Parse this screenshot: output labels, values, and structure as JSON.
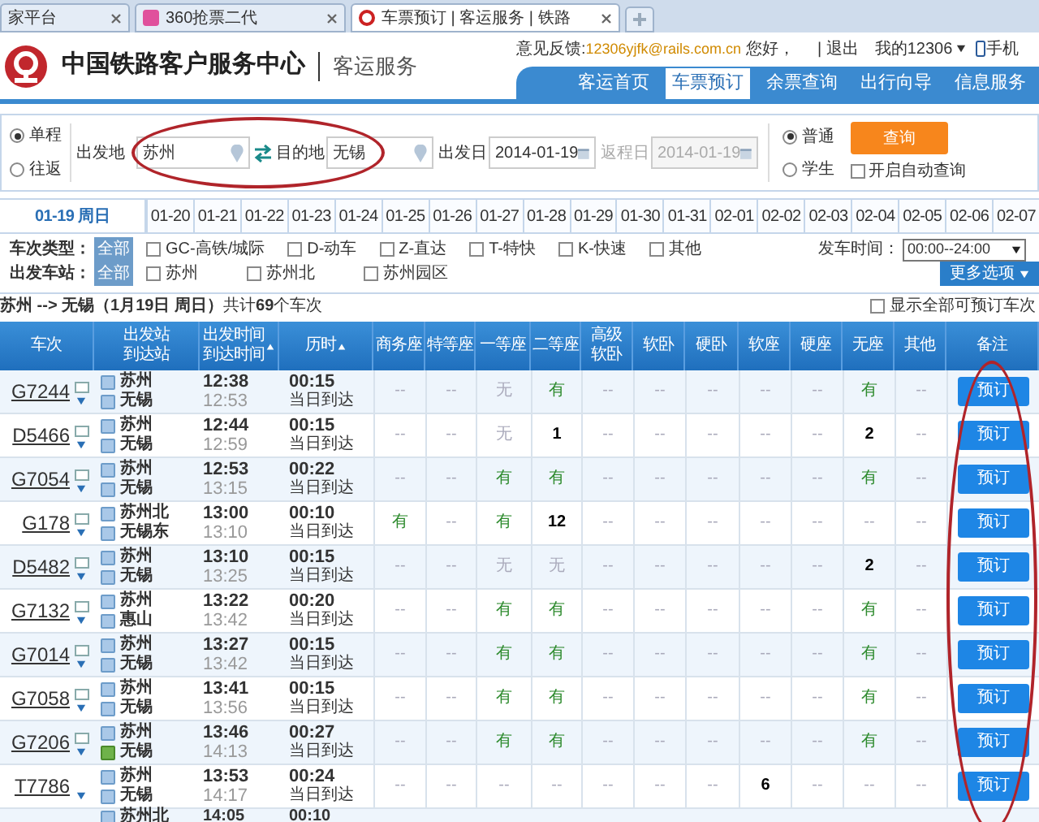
{
  "browser_tabs": [
    {
      "label": "家平台",
      "selected": false,
      "icon": false
    },
    {
      "label": "360抢票二代",
      "selected": false,
      "icon": true
    },
    {
      "label": "车票预订 | 客运服务 | 铁路",
      "selected": true,
      "icon": true
    }
  ],
  "header": {
    "title": "中国铁路客户服务中心",
    "subtitle": "客运服务",
    "feedback_label": "意见反馈:",
    "feedback_email": "12306yjfk@rails.com.cn",
    "greeting": "您好，",
    "logout": "| 退出",
    "my_account": "我的12306",
    "mobile": "手机"
  },
  "nav": [
    {
      "label": "客运首页",
      "selected": false
    },
    {
      "label": "车票预订",
      "selected": true
    },
    {
      "label": "余票查询",
      "selected": false
    },
    {
      "label": "出行向导",
      "selected": false
    },
    {
      "label": "信息服务",
      "selected": false
    }
  ],
  "search": {
    "trip_types": [
      {
        "label": "单程",
        "selected": true
      },
      {
        "label": "往返",
        "selected": false
      }
    ],
    "from_label": "出发地",
    "from": "苏州",
    "to_label": "目的地",
    "to": "无锡",
    "date_label": "出发日",
    "date": "2014-01-19",
    "return_label": "返程日",
    "return_date": "2014-01-19",
    "return_disabled": true,
    "passenger_types": [
      {
        "label": "普通",
        "selected": true
      },
      {
        "label": "学生",
        "selected": false
      }
    ],
    "query_button": "查询",
    "auto_query": {
      "label": "开启自动查询",
      "checked": false
    }
  },
  "dates": [
    {
      "label": "01-19 周日",
      "selected": true
    },
    {
      "label": "01-20",
      "selected": false
    },
    {
      "label": "01-21",
      "selected": false
    },
    {
      "label": "01-22",
      "selected": false
    },
    {
      "label": "01-23",
      "selected": false
    },
    {
      "label": "01-24",
      "selected": false
    },
    {
      "label": "01-25",
      "selected": false
    },
    {
      "label": "01-26",
      "selected": false
    },
    {
      "label": "01-27",
      "selected": false
    },
    {
      "label": "01-28",
      "selected": false
    },
    {
      "label": "01-29",
      "selected": false
    },
    {
      "label": "01-30",
      "selected": false
    },
    {
      "label": "01-31",
      "selected": false
    },
    {
      "label": "02-01",
      "selected": false
    },
    {
      "label": "02-02",
      "selected": false
    },
    {
      "label": "02-03",
      "selected": false
    },
    {
      "label": "02-04",
      "selected": false
    },
    {
      "label": "02-05",
      "selected": false
    },
    {
      "label": "02-06",
      "selected": false
    },
    {
      "label": "02-07",
      "selected": false
    }
  ],
  "filters": {
    "train_type_label": "车次类型：",
    "train_type_all": "全部",
    "train_types": [
      {
        "label": "GC-高铁/城际",
        "checked": false
      },
      {
        "label": "D-动车",
        "checked": false
      },
      {
        "label": "Z-直达",
        "checked": false
      },
      {
        "label": "T-特快",
        "checked": false
      },
      {
        "label": "K-快速",
        "checked": false
      },
      {
        "label": "其他",
        "checked": false
      }
    ],
    "depart_time_label": "发车时间：",
    "depart_time": "00:00--24:00",
    "station_label": "出发车站：",
    "station_all": "全部",
    "stations": [
      {
        "label": "苏州",
        "checked": false
      },
      {
        "label": "苏州北",
        "checked": false
      },
      {
        "label": "苏州园区",
        "checked": false
      }
    ],
    "more_options": "更多选项"
  },
  "summary": "**苏州 --> 无锡（1月19日  周日）**共计**69**个车次",
  "show_all": {
    "label": "显示全部可预订车次",
    "checked": false
  },
  "table": {
    "columns": [
      {
        "lines": [
          "车次"
        ],
        "sort": false
      },
      {
        "lines": [
          "出发站",
          "到达站"
        ],
        "sort": false
      },
      {
        "lines": [
          "出发时间",
          "到达时间"
        ],
        "sort": true
      },
      {
        "lines": [
          "历时"
        ],
        "sort": true
      },
      {
        "lines": [
          "商务座"
        ],
        "sort": false
      },
      {
        "lines": [
          "特等座"
        ],
        "sort": false
      },
      {
        "lines": [
          "一等座"
        ],
        "sort": false
      },
      {
        "lines": [
          "二等座"
        ],
        "sort": false
      },
      {
        "lines": [
          "高级",
          "软卧"
        ],
        "sort": false
      },
      {
        "lines": [
          "软卧"
        ],
        "sort": false
      },
      {
        "lines": [
          "硬卧"
        ],
        "sort": false
      },
      {
        "lines": [
          "软座"
        ],
        "sort": false
      },
      {
        "lines": [
          "硬座"
        ],
        "sort": false
      },
      {
        "lines": [
          "无座"
        ],
        "sort": false
      },
      {
        "lines": [
          "其他"
        ],
        "sort": false
      },
      {
        "lines": [
          "备注"
        ],
        "sort": false
      }
    ],
    "rows": [
      {
        "train": "G7244",
        "info_icon": true,
        "from": "苏州",
        "to": "无锡",
        "to_terminal": false,
        "depart": "12:38",
        "arrive": "12:53",
        "duration": "00:15",
        "arrival_day": "当日到达",
        "button": "预订",
        "seats": [
          {
            "value": "--",
            "kind": "none"
          },
          {
            "value": "--",
            "kind": "none"
          },
          {
            "value": "无",
            "kind": "none"
          },
          {
            "value": "有",
            "kind": "yes"
          },
          {
            "value": "--",
            "kind": "none"
          },
          {
            "value": "--",
            "kind": "none"
          },
          {
            "value": "--",
            "kind": "none"
          },
          {
            "value": "--",
            "kind": "none"
          },
          {
            "value": "--",
            "kind": "none"
          },
          {
            "value": "有",
            "kind": "yes"
          },
          {
            "value": "--",
            "kind": "none"
          }
        ]
      },
      {
        "train": "D5466",
        "info_icon": true,
        "from": "苏州",
        "to": "无锡",
        "to_terminal": false,
        "depart": "12:44",
        "arrive": "12:59",
        "duration": "00:15",
        "arrival_day": "当日到达",
        "button": "预订",
        "seats": [
          {
            "value": "--",
            "kind": "none"
          },
          {
            "value": "--",
            "kind": "none"
          },
          {
            "value": "无",
            "kind": "none"
          },
          {
            "value": "1",
            "kind": "count"
          },
          {
            "value": "--",
            "kind": "none"
          },
          {
            "value": "--",
            "kind": "none"
          },
          {
            "value": "--",
            "kind": "none"
          },
          {
            "value": "--",
            "kind": "none"
          },
          {
            "value": "--",
            "kind": "none"
          },
          {
            "value": "2",
            "kind": "count"
          },
          {
            "value": "--",
            "kind": "none"
          }
        ]
      },
      {
        "train": "G7054",
        "info_icon": true,
        "from": "苏州",
        "to": "无锡",
        "to_terminal": false,
        "depart": "12:53",
        "arrive": "13:15",
        "duration": "00:22",
        "arrival_day": "当日到达",
        "button": "预订",
        "seats": [
          {
            "value": "--",
            "kind": "none"
          },
          {
            "value": "--",
            "kind": "none"
          },
          {
            "value": "有",
            "kind": "yes"
          },
          {
            "value": "有",
            "kind": "yes"
          },
          {
            "value": "--",
            "kind": "none"
          },
          {
            "value": "--",
            "kind": "none"
          },
          {
            "value": "--",
            "kind": "none"
          },
          {
            "value": "--",
            "kind": "none"
          },
          {
            "value": "--",
            "kind": "none"
          },
          {
            "value": "有",
            "kind": "yes"
          },
          {
            "value": "--",
            "kind": "none"
          }
        ]
      },
      {
        "train": "G178",
        "info_icon": true,
        "from": "苏州北",
        "to": "无锡东",
        "to_terminal": false,
        "depart": "13:00",
        "arrive": "13:10",
        "duration": "00:10",
        "arrival_day": "当日到达",
        "button": "预订",
        "seats": [
          {
            "value": "有",
            "kind": "yes"
          },
          {
            "value": "--",
            "kind": "none"
          },
          {
            "value": "有",
            "kind": "yes"
          },
          {
            "value": "12",
            "kind": "count"
          },
          {
            "value": "--",
            "kind": "none"
          },
          {
            "value": "--",
            "kind": "none"
          },
          {
            "value": "--",
            "kind": "none"
          },
          {
            "value": "--",
            "kind": "none"
          },
          {
            "value": "--",
            "kind": "none"
          },
          {
            "value": "--",
            "kind": "none"
          },
          {
            "value": "--",
            "kind": "none"
          }
        ]
      },
      {
        "train": "D5482",
        "info_icon": true,
        "from": "苏州",
        "to": "无锡",
        "to_terminal": false,
        "depart": "13:10",
        "arrive": "13:25",
        "duration": "00:15",
        "arrival_day": "当日到达",
        "button": "预订",
        "seats": [
          {
            "value": "--",
            "kind": "none"
          },
          {
            "value": "--",
            "kind": "none"
          },
          {
            "value": "无",
            "kind": "none"
          },
          {
            "value": "无",
            "kind": "none"
          },
          {
            "value": "--",
            "kind": "none"
          },
          {
            "value": "--",
            "kind": "none"
          },
          {
            "value": "--",
            "kind": "none"
          },
          {
            "value": "--",
            "kind": "none"
          },
          {
            "value": "--",
            "kind": "none"
          },
          {
            "value": "2",
            "kind": "count"
          },
          {
            "value": "--",
            "kind": "none"
          }
        ]
      },
      {
        "train": "G7132",
        "info_icon": true,
        "from": "苏州",
        "to": "惠山",
        "to_terminal": false,
        "depart": "13:22",
        "arrive": "13:42",
        "duration": "00:20",
        "arrival_day": "当日到达",
        "button": "预订",
        "seats": [
          {
            "value": "--",
            "kind": "none"
          },
          {
            "value": "--",
            "kind": "none"
          },
          {
            "value": "有",
            "kind": "yes"
          },
          {
            "value": "有",
            "kind": "yes"
          },
          {
            "value": "--",
            "kind": "none"
          },
          {
            "value": "--",
            "kind": "none"
          },
          {
            "value": "--",
            "kind": "none"
          },
          {
            "value": "--",
            "kind": "none"
          },
          {
            "value": "--",
            "kind": "none"
          },
          {
            "value": "有",
            "kind": "yes"
          },
          {
            "value": "--",
            "kind": "none"
          }
        ]
      },
      {
        "train": "G7014",
        "info_icon": true,
        "from": "苏州",
        "to": "无锡",
        "to_terminal": false,
        "depart": "13:27",
        "arrive": "13:42",
        "duration": "00:15",
        "arrival_day": "当日到达",
        "button": "预订",
        "seats": [
          {
            "value": "--",
            "kind": "none"
          },
          {
            "value": "--",
            "kind": "none"
          },
          {
            "value": "有",
            "kind": "yes"
          },
          {
            "value": "有",
            "kind": "yes"
          },
          {
            "value": "--",
            "kind": "none"
          },
          {
            "value": "--",
            "kind": "none"
          },
          {
            "value": "--",
            "kind": "none"
          },
          {
            "value": "--",
            "kind": "none"
          },
          {
            "value": "--",
            "kind": "none"
          },
          {
            "value": "有",
            "kind": "yes"
          },
          {
            "value": "--",
            "kind": "none"
          }
        ]
      },
      {
        "train": "G7058",
        "info_icon": true,
        "from": "苏州",
        "to": "无锡",
        "to_terminal": false,
        "depart": "13:41",
        "arrive": "13:56",
        "duration": "00:15",
        "arrival_day": "当日到达",
        "button": "预订",
        "seats": [
          {
            "value": "--",
            "kind": "none"
          },
          {
            "value": "--",
            "kind": "none"
          },
          {
            "value": "有",
            "kind": "yes"
          },
          {
            "value": "有",
            "kind": "yes"
          },
          {
            "value": "--",
            "kind": "none"
          },
          {
            "value": "--",
            "kind": "none"
          },
          {
            "value": "--",
            "kind": "none"
          },
          {
            "value": "--",
            "kind": "none"
          },
          {
            "value": "--",
            "kind": "none"
          },
          {
            "value": "有",
            "kind": "yes"
          },
          {
            "value": "--",
            "kind": "none"
          }
        ]
      },
      {
        "train": "G7206",
        "info_icon": true,
        "from": "苏州",
        "to": "无锡",
        "to_terminal": true,
        "depart": "13:46",
        "arrive": "14:13",
        "duration": "00:27",
        "arrival_day": "当日到达",
        "button": "预订",
        "seats": [
          {
            "value": "--",
            "kind": "none"
          },
          {
            "value": "--",
            "kind": "none"
          },
          {
            "value": "有",
            "kind": "yes"
          },
          {
            "value": "有",
            "kind": "yes"
          },
          {
            "value": "--",
            "kind": "none"
          },
          {
            "value": "--",
            "kind": "none"
          },
          {
            "value": "--",
            "kind": "none"
          },
          {
            "value": "--",
            "kind": "none"
          },
          {
            "value": "--",
            "kind": "none"
          },
          {
            "value": "有",
            "kind": "yes"
          },
          {
            "value": "--",
            "kind": "none"
          }
        ]
      },
      {
        "train": "T7786",
        "info_icon": false,
        "from": "苏州",
        "to": "无锡",
        "to_terminal": false,
        "depart": "13:53",
        "arrive": "14:17",
        "duration": "00:24",
        "arrival_day": "当日到达",
        "button": "预订",
        "seats": [
          {
            "value": "--",
            "kind": "none"
          },
          {
            "value": "--",
            "kind": "none"
          },
          {
            "value": "--",
            "kind": "none"
          },
          {
            "value": "--",
            "kind": "none"
          },
          {
            "value": "--",
            "kind": "none"
          },
          {
            "value": "--",
            "kind": "none"
          },
          {
            "value": "--",
            "kind": "none"
          },
          {
            "value": "6",
            "kind": "count"
          },
          {
            "value": "--",
            "kind": "none"
          },
          {
            "value": "--",
            "kind": "none"
          },
          {
            "value": "--",
            "kind": "none"
          }
        ]
      }
    ],
    "partial_row": {
      "from": "苏州北",
      "depart": "14:05",
      "duration": "00:10"
    }
  }
}
